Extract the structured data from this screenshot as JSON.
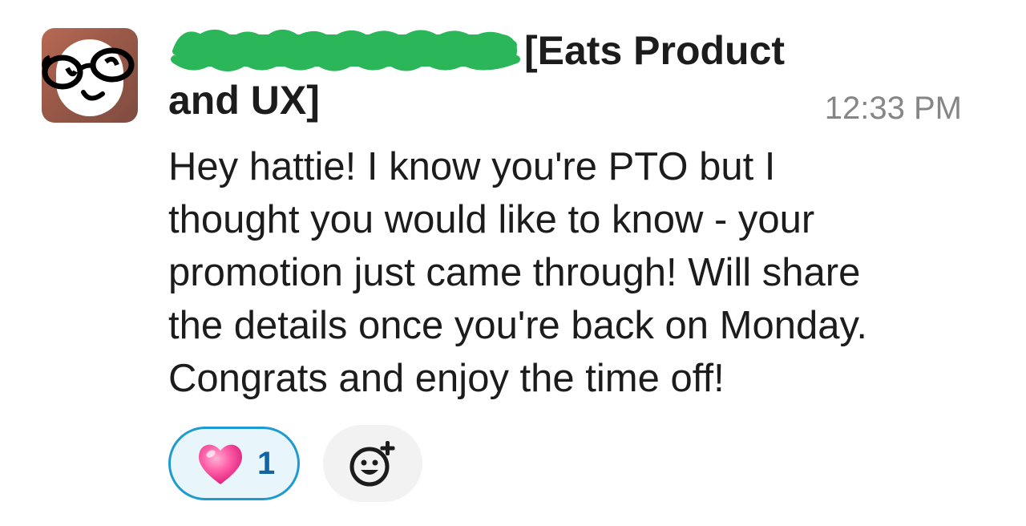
{
  "message": {
    "sender_suffix_line1": "[Eats Product",
    "sender_suffix_line2": "and UX]",
    "timestamp": "12:33 PM",
    "text": "Hey hattie! I know you're PTO but I\nthought you would like to know - your\npromotion just came through! Will share\nthe details once you're back on Monday.\nCongrats and enjoy the time off!"
  },
  "reactions": [
    {
      "emoji": "heart-icon",
      "count": "1"
    }
  ],
  "colors": {
    "redaction": "#2bb65a",
    "reaction_border": "#1d9bd1",
    "reaction_bg": "#e8f5fa",
    "reaction_count": "#1264a3",
    "timestamp": "#868686"
  }
}
